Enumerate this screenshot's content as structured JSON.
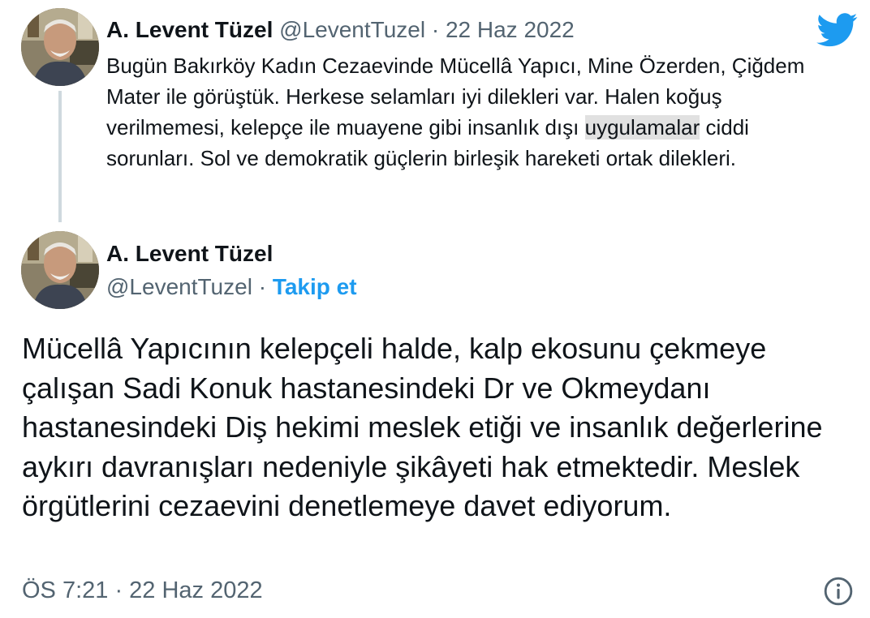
{
  "parent_tweet": {
    "author_name": "A. Levent Tüzel",
    "handle": "@LeventTuzel",
    "separator": "·",
    "date": "22 Haz 2022",
    "text_before_highlight": "Bugün Bakırköy Kadın Cezaevinde Mücellâ Yapıcı, Mine Özerden, Çiğdem Mater ile görüştük. Herkese selamları iyi dilekleri var. Halen koğuş verilmemesi, kelepçe ile muayene gibi insanlık dışı ",
    "highlighted_text": "uygulamalar",
    "text_after_highlight": " ciddi sorunları. Sol ve demokratik güçlerin birleşik hareketi ortak dilekleri."
  },
  "main_tweet": {
    "author_name": "A. Levent Tüzel",
    "handle": "@LeventTuzel",
    "separator": "·",
    "follow_label": "Takip et",
    "text": "Mücellâ Yapıcının kelepçeli halde, kalp ekosunu çekmeye çalışan Sadi Konuk hastanesindeki Dr ve Okmeydanı hastanesindeki Diş hekimi meslek etiği ve insanlık değerlerine aykırı davranışları nedeniyle şikâyeti hak etmektedir. Meslek örgütlerini cezaevini denetlemeye davet ediyorum.",
    "timestamp": "ÖS 7:21 · 22 Haz 2022"
  },
  "icons": {
    "brand": "twitter-bird-icon",
    "info": "info-icon"
  },
  "colors": {
    "brand_blue": "#1d9bf0",
    "secondary_text": "#536471",
    "primary_text": "#0f1419",
    "highlight": "#e1e1e1",
    "thread_line": "#cfd9de"
  }
}
